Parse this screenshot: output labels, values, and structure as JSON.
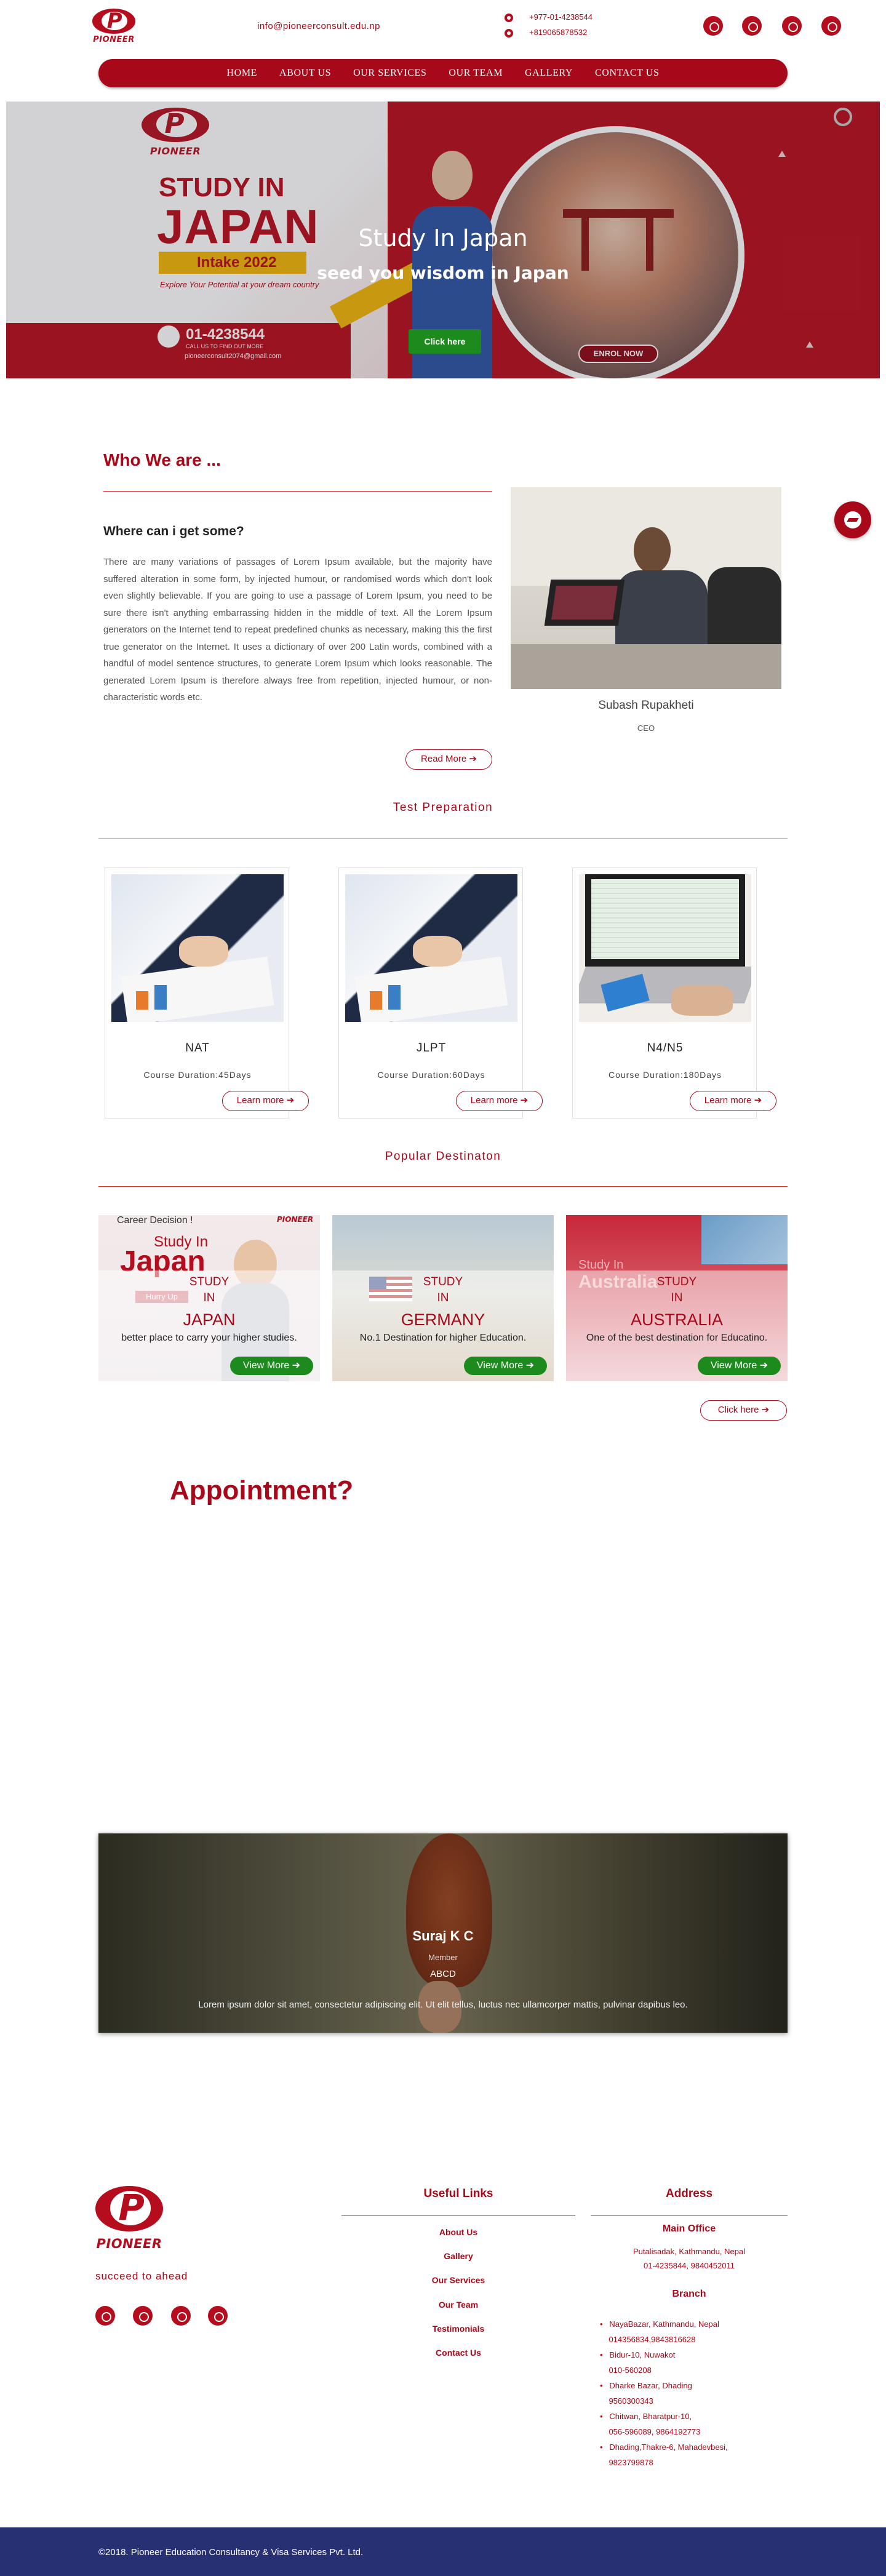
{
  "header": {
    "logo_text": "PIONEER",
    "email": "info@pioneerconsult.edu.np",
    "phones": [
      "+977-01-4238544",
      "+819065878532"
    ],
    "social_icons": [
      "facebook-icon",
      "whatsapp-icon",
      "viber-icon",
      "instagram-icon"
    ]
  },
  "nav": {
    "items": [
      "HOME",
      "ABOUT US",
      "OUR SERVICES",
      "OUR TEAM",
      "GALLERY",
      "CONTACT US"
    ]
  },
  "hero": {
    "title": "Study In Japan",
    "subtitle": "seed you wisdom in Japan",
    "button": "Click here",
    "banner": {
      "study_in": "STUDY IN",
      "japan": "JAPAN",
      "intake": "Intake 2022",
      "explore": "Explore Your Potential at your dream country",
      "phone": "01-4238544",
      "call": "CALL US TO FIND OUT MORE",
      "mail": "pioneerconsult2074@gmail.com",
      "enrol": "ENROL NOW"
    }
  },
  "about": {
    "title": "Who We are ...",
    "heading": "Where can i get some?",
    "text": "There are many variations of passages of Lorem Ipsum available, but the majority have suffered alteration in some form, by injected humour, or randomised words which don't look even slightly believable. If you are going to use a passage of Lorem Ipsum, you need to be sure there isn't anything embarrassing hidden in the middle of text. All the Lorem Ipsum generators on the Internet tend to repeat predefined chunks as necessary, making this the first true generator on the Internet. It uses a dictionary of over 200 Latin words, combined with a handful of model sentence structures, to generate Lorem Ipsum which looks reasonable. The generated Lorem Ipsum is therefore always free from repetition, injected humour, or non-characteristic words etc.",
    "read_more": "Read More",
    "ceo_name": "Subash Rupakheti",
    "ceo_role": "CEO"
  },
  "tests": {
    "title": "Test Preparation",
    "button": "Learn more",
    "items": [
      {
        "name": "NAT",
        "duration": "Course Duration:45Days"
      },
      {
        "name": "JLPT",
        "duration": "Course Duration:60Days"
      },
      {
        "name": "N4/N5",
        "duration": "Course Duration:180Days"
      }
    ]
  },
  "destinations": {
    "title": "Popular Destinaton",
    "study": "STUDY",
    "in": "IN",
    "button": "View More",
    "click_here": "Click here",
    "items": [
      {
        "country": "JAPAN",
        "desc": "better place to carry your higher studies."
      },
      {
        "country": "GERMANY",
        "desc": "No.1 Destination for higher Education."
      },
      {
        "country": "AUSTRALIA",
        "desc": "One of the best destination for Educatino."
      }
    ],
    "japan_bg": {
      "career": "Career Decision !",
      "study_in": "Study In",
      "japan": "Japan",
      "hurry": "Hurry Up",
      "brand": "PIONEER"
    },
    "australia_bg": {
      "study_in": "Study In",
      "australia": "Australia"
    }
  },
  "appointment": {
    "title": "Appointment?"
  },
  "testimonial": {
    "name": "Suraj K C",
    "role": "Member",
    "org": "ABCD",
    "quote": "Lorem ipsum dolor sit amet, consectetur adipiscing elit. Ut elit tellus, luctus nec ullamcorper mattis, pulvinar dapibus leo."
  },
  "footer": {
    "tagline": "succeed to ahead",
    "useful_title": "Useful Links",
    "links": [
      "About Us",
      "Gallery",
      "Our Services",
      "Our Team",
      "Testimonials",
      "Contact Us"
    ],
    "address_title": "Address",
    "main_office_title": "Main Office",
    "main_office": [
      "Putalisadak, Kathmandu, Nepal",
      "01-4235844, 9840452011"
    ],
    "branch_title": "Branch",
    "branches": [
      [
        "NayaBazar, Kathmandu, Nepal",
        "014356834,9843816628"
      ],
      [
        "Bidur-10, Nuwakot",
        "010-560208"
      ],
      [
        "Dharke Bazar, Dhading",
        "9560300343"
      ],
      [
        "Chitwan, Bharatpur-10,",
        "056-596089, 9864192773"
      ],
      [
        "Dhading,Thakre-6, Mahadevbesi,",
        "9823799878"
      ]
    ]
  },
  "copyright": "©2018. Pioneer Education Consultancy & Visa Services Pvt. Ltd.",
  "colors": {
    "brand": "#a8091a",
    "green": "#1c8a1c",
    "footer_bar": "#283074"
  }
}
